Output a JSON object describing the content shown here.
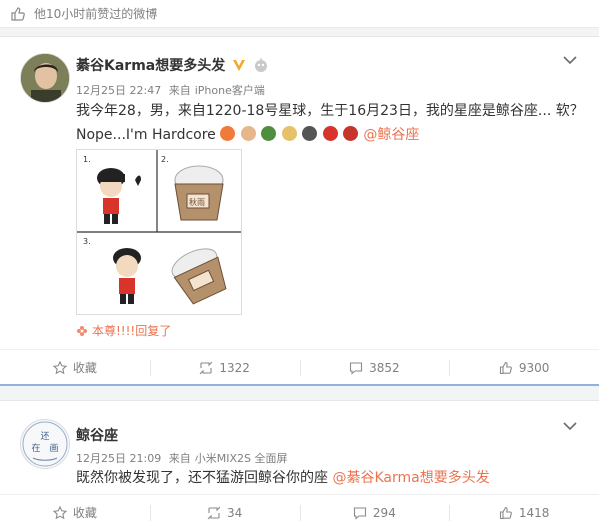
{
  "liked_header": {
    "text": "他10小时前赞过的微博"
  },
  "posts": [
    {
      "author": "綦谷Karma想要多头发",
      "time": "12月25日 22:47",
      "source_prefix": "来自",
      "source": "iPhone客户端",
      "line1": "我今年28，男，来自1220-18号星球，生于16月23日，我的星座是鲸谷座... 软？",
      "line2_prefix": "Nope...I'm Hardcore",
      "mention": "@鲸谷座",
      "liker": "本尊!!!!回复了",
      "actions": {
        "fav": "收藏",
        "repost": "1322",
        "comment": "3852",
        "like": "9300"
      }
    },
    {
      "author": "鲸谷座",
      "time": "12月25日 21:09",
      "source_prefix": "来自",
      "source": "小米MIX2S 全面屏",
      "text_prefix": "既然你被发现了，还不猛游回鲸谷你的座 ",
      "mention": "@綦谷Karma想要多头发",
      "actions": {
        "fav": "收藏",
        "repost": "34",
        "comment": "294",
        "like": "1418"
      }
    }
  ],
  "colors": {
    "accent": "#eb7350",
    "muted": "#808080",
    "verified": "#f5a623"
  }
}
